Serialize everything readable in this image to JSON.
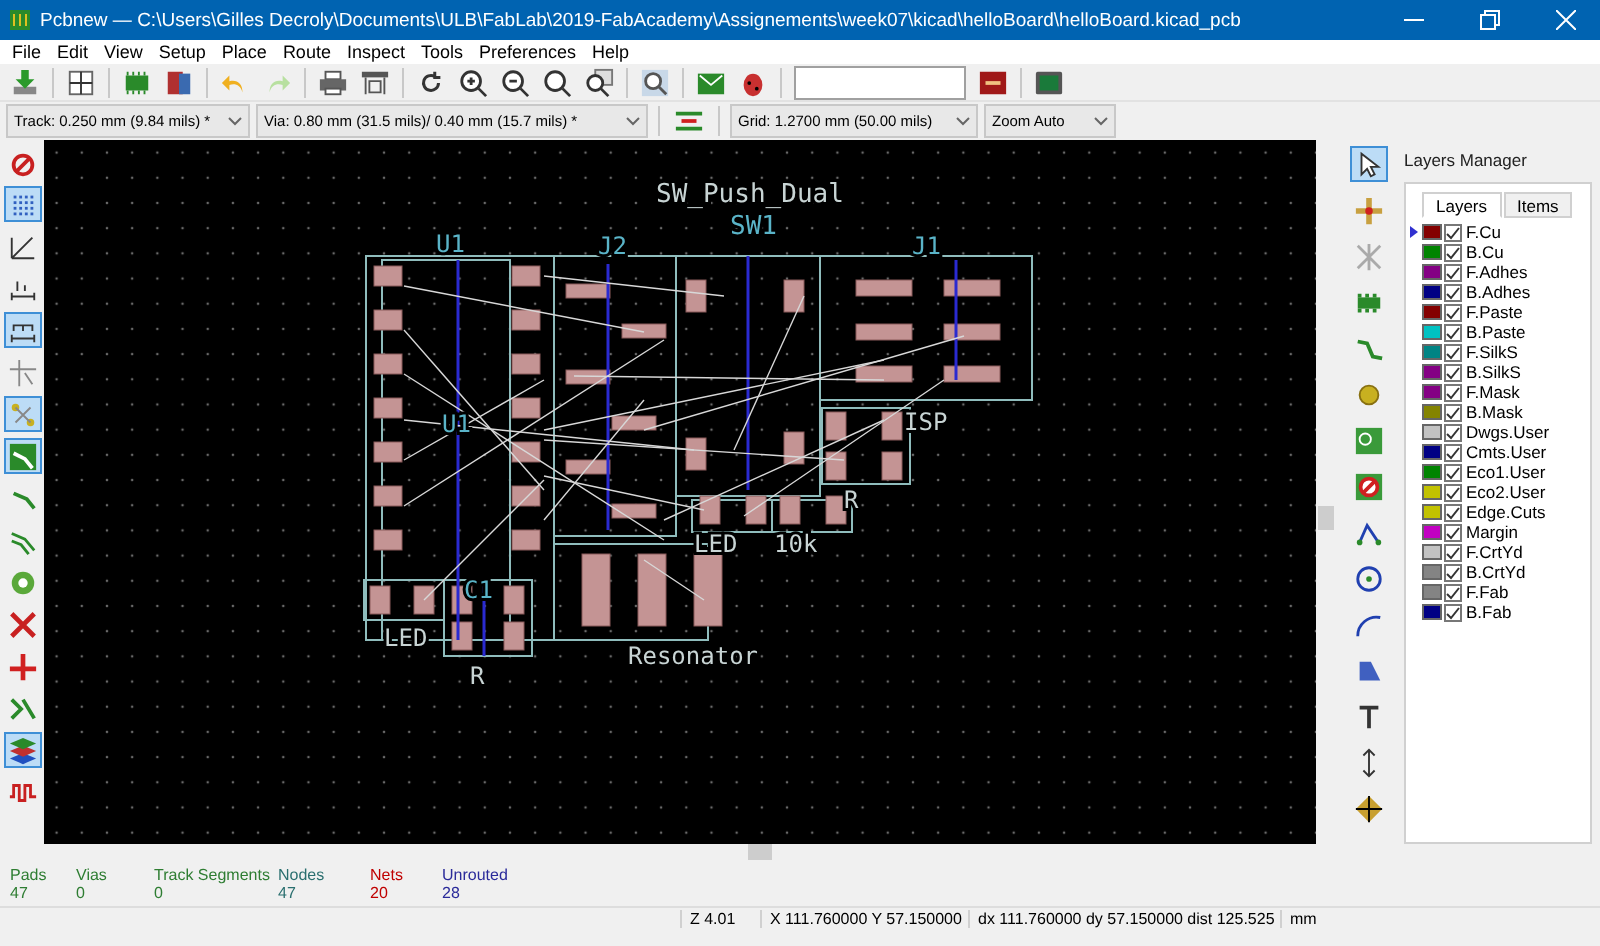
{
  "window": {
    "title": "Pcbnew — C:\\Users\\Gilles Decroly\\Documents\\ULB\\FabLab\\2019-FabAcademy\\Assignements\\week07\\kicad\\helloBoard\\helloBoard.kicad_pcb"
  },
  "menu": [
    "File",
    "Edit",
    "View",
    "Setup",
    "Place",
    "Route",
    "Inspect",
    "Tools",
    "Preferences",
    "Help"
  ],
  "options_bar": {
    "track": "Track: 0.250 mm (9.84 mils) *",
    "via": "Via: 0.80 mm (31.5 mils)/ 0.40 mm (15.7 mils) *",
    "grid": "Grid: 1.2700 mm (50.00 mils)",
    "zoom": "Zoom Auto"
  },
  "left_toolbar": [
    {
      "selected": false
    },
    {
      "selected": true
    },
    {
      "selected": false
    },
    {
      "selected": false
    },
    {
      "selected": true
    },
    {
      "selected": false
    },
    {
      "selected": true
    },
    {
      "selected": true
    },
    {
      "selected": false
    },
    {
      "selected": false
    },
    {
      "selected": false
    },
    {
      "selected": false
    },
    {
      "selected": false
    },
    {
      "selected": false
    },
    {
      "selected": true
    },
    {
      "selected": false
    }
  ],
  "right_toolbar": [
    {
      "selected": true
    },
    {
      "selected": false
    },
    {
      "selected": false
    },
    {
      "selected": false
    },
    {
      "selected": false
    },
    {
      "selected": false
    },
    {
      "selected": false
    },
    {
      "selected": false
    },
    {
      "selected": false
    },
    {
      "selected": false
    },
    {
      "selected": false
    },
    {
      "selected": false
    },
    {
      "selected": false
    },
    {
      "selected": false
    },
    {
      "selected": false
    }
  ],
  "canvas": {
    "labels": [
      "SW_Push_Dual",
      "SW1",
      "U1",
      "J2",
      "J1",
      "U1",
      "ISP",
      "LED",
      "10k",
      "R",
      "LED",
      "C1",
      "R",
      "Resonator"
    ]
  },
  "layers_manager": {
    "title": "Layers Manager",
    "tabs": [
      {
        "label": "Layers",
        "selected": true
      },
      {
        "label": "Items",
        "selected": false
      }
    ],
    "layers": [
      {
        "name": "F.Cu",
        "color": "#840000",
        "checked": true,
        "selected": true
      },
      {
        "name": "B.Cu",
        "color": "#008400",
        "checked": true,
        "selected": false
      },
      {
        "name": "F.Adhes",
        "color": "#840084",
        "checked": true,
        "selected": false
      },
      {
        "name": "B.Adhes",
        "color": "#000084",
        "checked": true,
        "selected": false
      },
      {
        "name": "F.Paste",
        "color": "#840000",
        "checked": true,
        "selected": false
      },
      {
        "name": "B.Paste",
        "color": "#00c2c2",
        "checked": true,
        "selected": false
      },
      {
        "name": "F.SilkS",
        "color": "#008484",
        "checked": true,
        "selected": false
      },
      {
        "name": "B.SilkS",
        "color": "#840084",
        "checked": true,
        "selected": false
      },
      {
        "name": "F.Mask",
        "color": "#840084",
        "checked": true,
        "selected": false
      },
      {
        "name": "B.Mask",
        "color": "#848400",
        "checked": true,
        "selected": false
      },
      {
        "name": "Dwgs.User",
        "color": "#c2c2c2",
        "checked": true,
        "selected": false
      },
      {
        "name": "Cmts.User",
        "color": "#000084",
        "checked": true,
        "selected": false
      },
      {
        "name": "Eco1.User",
        "color": "#008400",
        "checked": true,
        "selected": false
      },
      {
        "name": "Eco2.User",
        "color": "#c2c200",
        "checked": true,
        "selected": false
      },
      {
        "name": "Edge.Cuts",
        "color": "#c2c200",
        "checked": true,
        "selected": false
      },
      {
        "name": "Margin",
        "color": "#c200c2",
        "checked": true,
        "selected": false
      },
      {
        "name": "F.CrtYd",
        "color": "#c2c2c2",
        "checked": true,
        "selected": false
      },
      {
        "name": "B.CrtYd",
        "color": "#848484",
        "checked": true,
        "selected": false
      },
      {
        "name": "F.Fab",
        "color": "#848484",
        "checked": true,
        "selected": false
      },
      {
        "name": "B.Fab",
        "color": "#000084",
        "checked": true,
        "selected": false
      }
    ]
  },
  "stats": [
    {
      "label": "Pads",
      "value": "47",
      "color": "#2e7d32"
    },
    {
      "label": "Vias",
      "value": "0",
      "color": "#2e7d32"
    },
    {
      "label": "Track Segments",
      "value": "0",
      "color": "#2e7d32"
    },
    {
      "label": "Nodes",
      "value": "47",
      "color": "#2a6f6f"
    },
    {
      "label": "Nets",
      "value": "20",
      "color": "#c00000"
    },
    {
      "label": "Unrouted",
      "value": "28",
      "color": "#2a2a9a"
    }
  ],
  "status_bar": {
    "zoom": "Z 4.01",
    "position": "X 111.760000  Y 57.150000",
    "delta": "dx 111.760000  dy 57.150000  dist 125.525",
    "units": "mm"
  }
}
